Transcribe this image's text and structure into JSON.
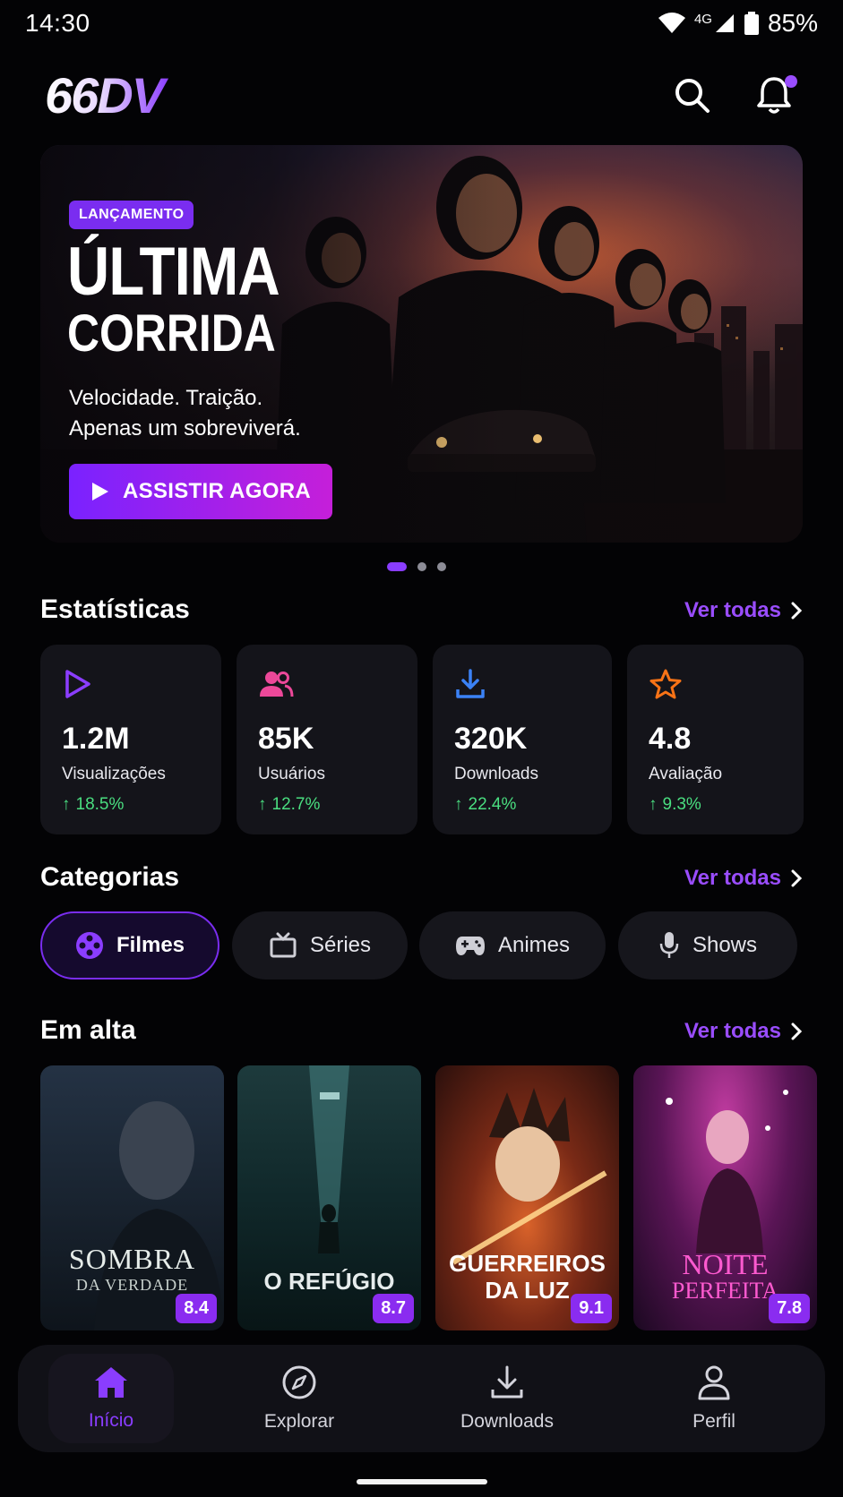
{
  "status_bar": {
    "time": "14:30",
    "network": "4G",
    "battery": "85%"
  },
  "header": {
    "logo_text": "66DV",
    "search_icon": "search-icon",
    "notification_icon": "bell-icon",
    "has_notification": true
  },
  "hero": {
    "badge": "LANÇAMENTO",
    "title_line1": "ÚLTIMA",
    "title_line2": "CORRIDA",
    "tagline_line1": "Velocidade. Traição.",
    "tagline_line2": "Apenas um sobreviverá.",
    "cta_label": "ASSISTIR AGORA",
    "carousel_total": 3,
    "carousel_active": 1
  },
  "stats": {
    "title": "Estatísticas",
    "see_all": "Ver todas",
    "items": [
      {
        "icon": "play-icon",
        "value": "1.2M",
        "label": "Visualizações",
        "change": "18.5%",
        "color": "#8b3dff"
      },
      {
        "icon": "users-icon",
        "value": "85K",
        "label": "Usuários",
        "change": "12.7%",
        "color": "#ec4899"
      },
      {
        "icon": "download-icon",
        "value": "320K",
        "label": "Downloads",
        "change": "22.4%",
        "color": "#3b82f6"
      },
      {
        "icon": "star-icon",
        "value": "4.8",
        "label": "Avaliação",
        "change": "9.3%",
        "color": "#f97316"
      }
    ]
  },
  "categories": {
    "title": "Categorias",
    "see_all": "Ver todas",
    "items": [
      {
        "icon": "film-reel-icon",
        "label": "Filmes",
        "active": true
      },
      {
        "icon": "tv-icon",
        "label": "Séries",
        "active": false
      },
      {
        "icon": "gamepad-icon",
        "label": "Animes",
        "active": false
      },
      {
        "icon": "microphone-icon",
        "label": "Shows",
        "active": false
      }
    ]
  },
  "trending": {
    "title": "Em alta",
    "see_all": "Ver todas",
    "items": [
      {
        "title_main": "SOMBRA",
        "title_sub": "DA VERDADE",
        "rating": "8.4"
      },
      {
        "title_main": "O REFÚGIO",
        "title_sub": "",
        "rating": "8.7"
      },
      {
        "title_main": "GUERREIROS",
        "title_sub": "DA LUZ",
        "rating": "9.1"
      },
      {
        "title_main": "NOITE",
        "title_sub": "PERFEITA",
        "rating": "7.8"
      }
    ]
  },
  "bottom_nav": {
    "items": [
      {
        "icon": "home-icon",
        "label": "Início",
        "active": true
      },
      {
        "icon": "compass-icon",
        "label": "Explorar",
        "active": false
      },
      {
        "icon": "download-icon",
        "label": "Downloads",
        "active": false
      },
      {
        "icon": "user-icon",
        "label": "Perfil",
        "active": false
      }
    ]
  },
  "colors": {
    "accent": "#8a3dff",
    "positive": "#4ade80",
    "background": "#030305",
    "card": "#14141a"
  }
}
